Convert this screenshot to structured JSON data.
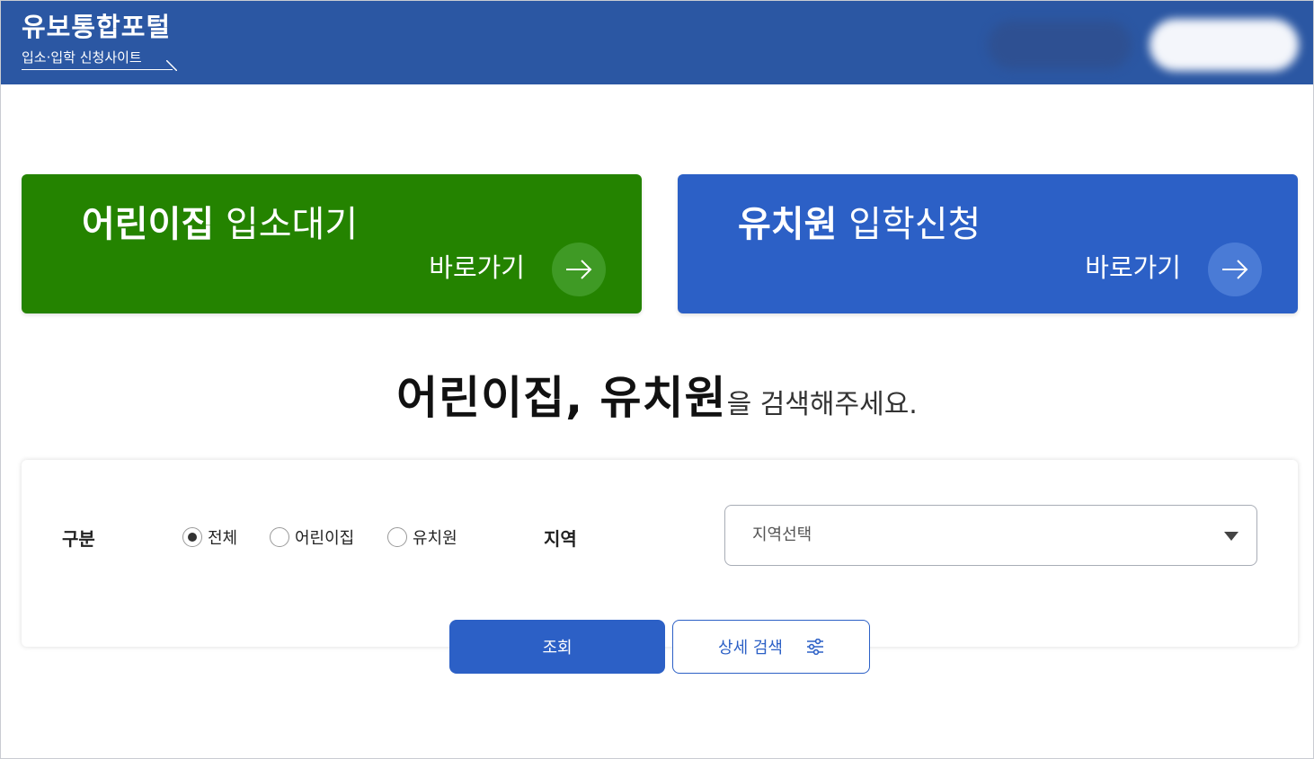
{
  "header": {
    "title": "유보통합포털",
    "subtitle": "입소·입학 신청사이트",
    "bg_color": "#2b57a3"
  },
  "cards": [
    {
      "title_bold": "어린이집",
      "title_light": "입소대기",
      "go_label": "바로가기",
      "color": "#248300",
      "icon": "arrow-right-icon"
    },
    {
      "title_bold": "유치원",
      "title_light": "입학신청",
      "go_label": "바로가기",
      "color": "#2c60c6",
      "icon": "arrow-right-icon"
    }
  ],
  "headline": {
    "bold": "어린이집, 유치원",
    "rest": "을 검색해주세요."
  },
  "search": {
    "category_label": "구분",
    "options": [
      {
        "label": "전체",
        "selected": true
      },
      {
        "label": "어린이집",
        "selected": false
      },
      {
        "label": "유치원",
        "selected": false
      }
    ],
    "region_label": "지역",
    "region_placeholder": "지역선택",
    "search_button": "조회",
    "detail_button": "상세 검색"
  },
  "accent_color": "#2c60c6"
}
